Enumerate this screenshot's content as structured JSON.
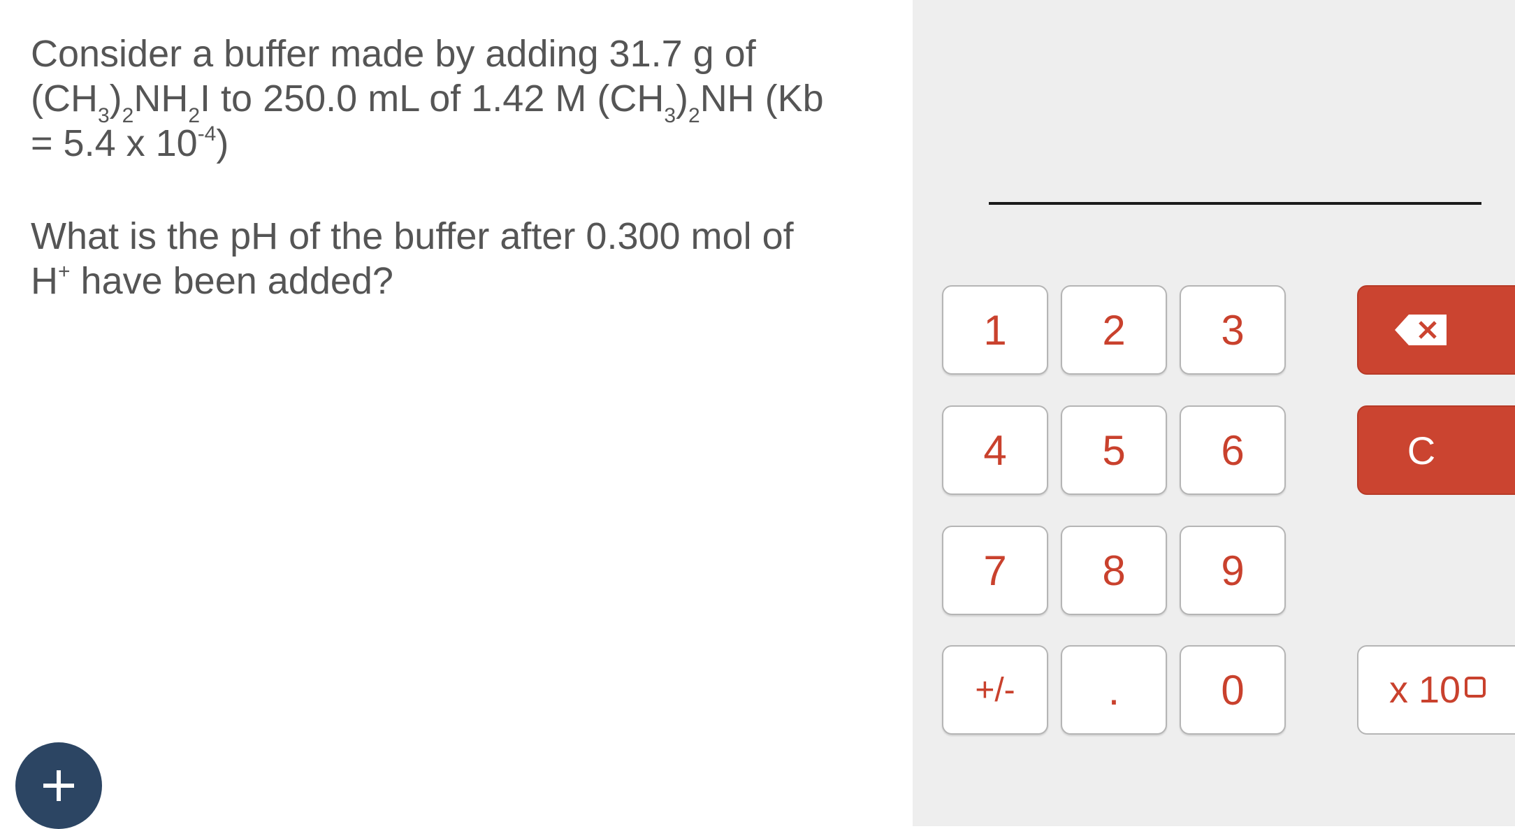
{
  "question": {
    "line1": "Consider a buffer made by adding 31.7 g of",
    "line2_parts": [
      "(CH",
      "3",
      ")",
      "2",
      "NH",
      "2",
      "I to 250.0 mL of 1.42 M (CH",
      "3",
      ")",
      "2",
      "NH (Kb"
    ],
    "line3_prefix": "= 5.4 x 10",
    "line3_exp": "-4",
    "line3_suffix": ")",
    "prompt_line1": "What is the pH of the buffer after 0.300 mol of",
    "prompt_line2_base": "H",
    "prompt_line2_sup": "+",
    "prompt_line2_rest": " have been added?"
  },
  "keypad": {
    "keys": [
      "1",
      "2",
      "3",
      "4",
      "5",
      "6",
      "7",
      "8",
      "9",
      "+/-",
      ".",
      "0"
    ],
    "clear_label": "C",
    "backspace_icon": "backspace-icon",
    "sci_label": "x 10",
    "sci_exponent_icon": "exponent-box-icon"
  },
  "add_button_icon": "plus-icon",
  "colors": {
    "accent_red": "#cb4430",
    "key_text": "#c9412d",
    "add_button": "#2c4563",
    "right_panel_bg": "#eeeeee"
  }
}
